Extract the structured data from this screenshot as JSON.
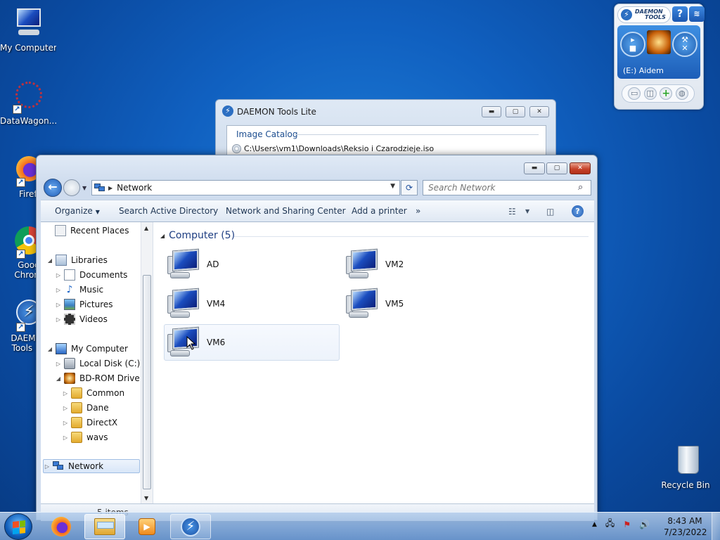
{
  "desktop": {
    "icons": [
      {
        "label": "My Computer",
        "icon": "computer-icon"
      },
      {
        "label": "DataWagon...",
        "icon": "datawagon-icon"
      },
      {
        "label": "Firefo",
        "icon": "firefox-icon"
      },
      {
        "label": "Googl Chrom",
        "icon": "chrome-icon"
      },
      {
        "label": "DAEMO Tools Li",
        "icon": "daemon-tools-icon"
      },
      {
        "label": "Recycle Bin",
        "icon": "recycle-bin-icon"
      }
    ]
  },
  "gadget": {
    "brand_line1": "DAEMON",
    "brand_line2": "TOOLS",
    "help_label": "?",
    "drive_label": "(E:) Aidem"
  },
  "daemon_window": {
    "title": "DAEMON Tools Lite",
    "catalog_title": "Image Catalog",
    "catalog_item": "C:\\Users\\vm1\\Downloads\\Reksio i Czarodzieje.iso"
  },
  "explorer": {
    "address": {
      "path": "Network"
    },
    "search": {
      "placeholder": "Search Network"
    },
    "commands": {
      "organize": "Organize",
      "search_ad": "Search Active Directory",
      "network_center": "Network and Sharing Center",
      "add_printer": "Add a printer",
      "more": "»"
    },
    "nav": {
      "recent": "Recent Places",
      "libraries": "Libraries",
      "documents": "Documents",
      "music": "Music",
      "pictures": "Pictures",
      "videos": "Videos",
      "my_computer": "My Computer",
      "local_disk": "Local Disk (C:)",
      "bdrom": "BD-ROM Drive (E",
      "common": "Common",
      "dane": "Dane",
      "directx": "DirectX",
      "wavs": "wavs",
      "network": "Network"
    },
    "group_header": "Computer (5)",
    "computers": [
      "AD",
      "VM2",
      "VM4",
      "VM5",
      "VM6"
    ],
    "status_text": "5 items"
  },
  "taskbar": {
    "clock_time": "8:43 AM",
    "clock_date": "7/23/2022"
  }
}
